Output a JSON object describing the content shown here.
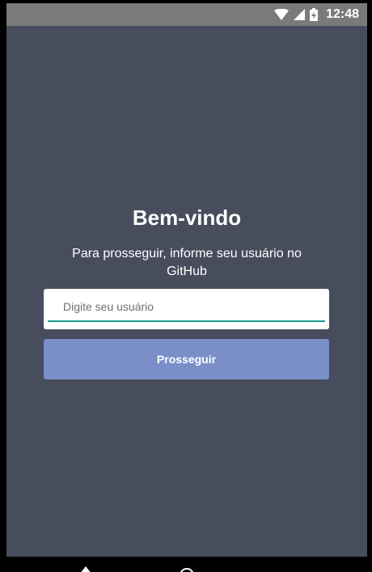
{
  "status_bar": {
    "time": "12:48",
    "icons": [
      "wifi-icon",
      "signal-icon",
      "battery-charging-icon"
    ]
  },
  "login": {
    "title": "Bem-vindo",
    "subtitle": "Para prosseguir, informe seu usuário no GitHub",
    "username_placeholder": "Digite seu usuário",
    "username_value": "",
    "submit_label": "Prosseguir"
  },
  "colors": {
    "background": "#474d5d",
    "accent_underline": "#1f9a8e",
    "button": "#7a8fc8",
    "status_bar": "#7a7a7a"
  },
  "nav_bar": {
    "icons": [
      "back-icon",
      "home-icon"
    ]
  }
}
